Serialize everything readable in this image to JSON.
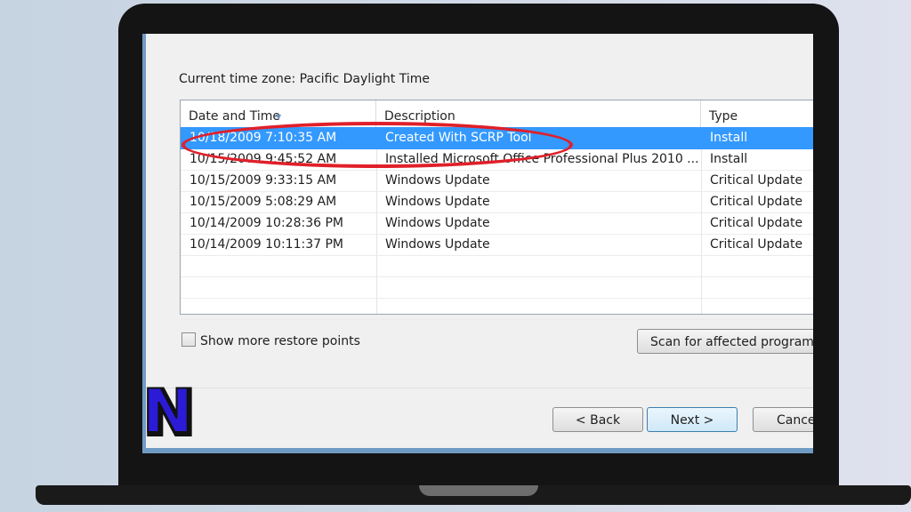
{
  "dialog": {
    "timezone_label": "Current time zone: Pacific Daylight Time",
    "columns": [
      "Date and Time",
      "Description",
      "Type"
    ],
    "rows": [
      {
        "date": "10/18/2009 7:10:35 AM",
        "description": "Created With SCRP Tool",
        "type": "Install",
        "selected": true
      },
      {
        "date": "10/15/2009 9:45:52 AM",
        "description": "Installed Microsoft Office Professional Plus 2010 ...",
        "type": "Install",
        "selected": false
      },
      {
        "date": "10/15/2009 9:33:15 AM",
        "description": "Windows Update",
        "type": "Critical Update",
        "selected": false
      },
      {
        "date": "10/15/2009 5:08:29 AM",
        "description": "Windows Update",
        "type": "Critical Update",
        "selected": false
      },
      {
        "date": "10/14/2009 10:28:36 PM",
        "description": "Windows Update",
        "type": "Critical Update",
        "selected": false
      },
      {
        "date": "10/14/2009 10:11:37 PM",
        "description": "Windows Update",
        "type": "Critical Update",
        "selected": false
      }
    ],
    "show_more_label": "Show more restore points",
    "show_more_checked": false,
    "scan_button": "Scan for affected programs",
    "back_button": "< Back",
    "next_button": "Next >",
    "cancel_button": "Cancel"
  },
  "logo": {
    "letter": "N",
    "color": "#2b1bd6"
  },
  "colors": {
    "selection": "#3399ff",
    "annotation": "#e0202a"
  }
}
